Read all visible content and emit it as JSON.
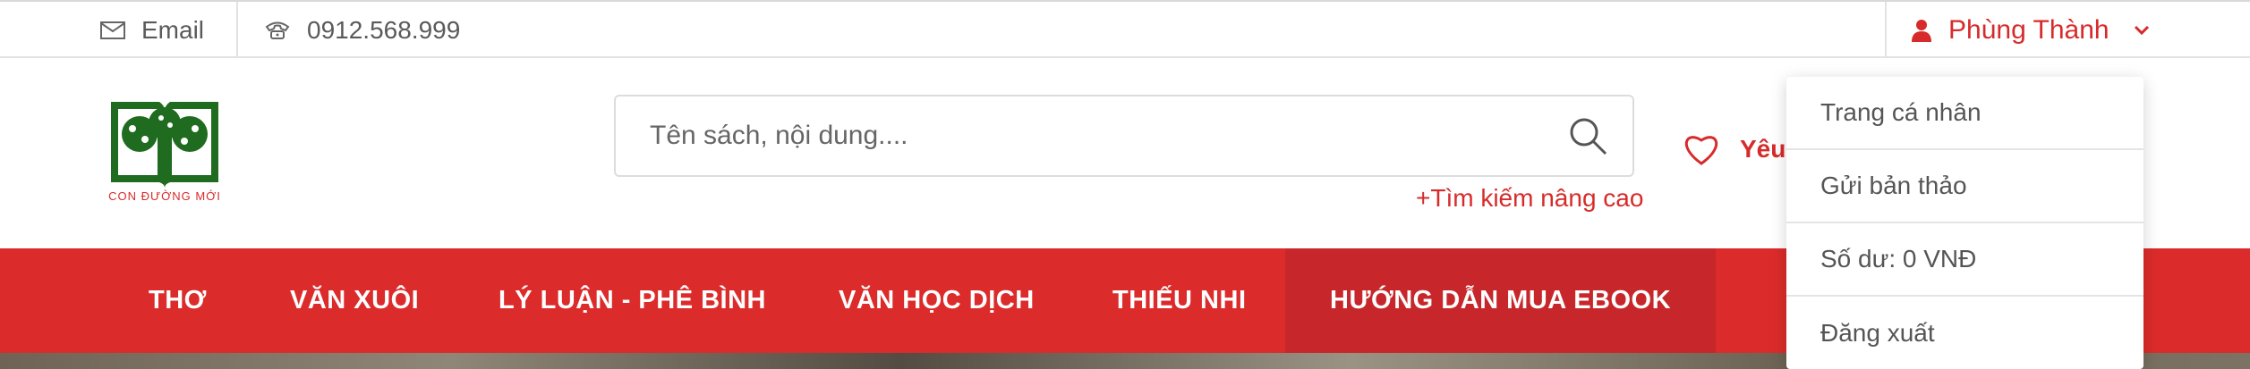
{
  "topbar": {
    "email_label": "Email",
    "phone": "0912.568.999",
    "user_name": "Phùng Thành"
  },
  "logo": {
    "text": "CON ĐƯỜNG MỚI"
  },
  "search": {
    "placeholder": "Tên sách, nội dung....",
    "advanced_label": "+Tìm kiếm nâng cao"
  },
  "wishlist": {
    "label": "Yêu"
  },
  "nav": {
    "items": [
      {
        "label": "THƠ"
      },
      {
        "label": "VĂN XUÔI"
      },
      {
        "label": "LÝ LUẬN - PHÊ BÌNH"
      },
      {
        "label": "VĂN HỌC DỊCH"
      },
      {
        "label": "THIẾU NHI"
      },
      {
        "label": "HƯỚNG DẪN MUA EBOOK"
      }
    ]
  },
  "user_menu": {
    "items": [
      {
        "label": "Trang cá nhân"
      },
      {
        "label": "Gửi bản thảo"
      },
      {
        "label": "Số dư: 0 VNĐ"
      },
      {
        "label": "Đăng xuất"
      }
    ]
  },
  "colors": {
    "brand_red": "#dc2b2b",
    "nav_active": "#c7272a",
    "logo_green": "#1f6b1f"
  }
}
